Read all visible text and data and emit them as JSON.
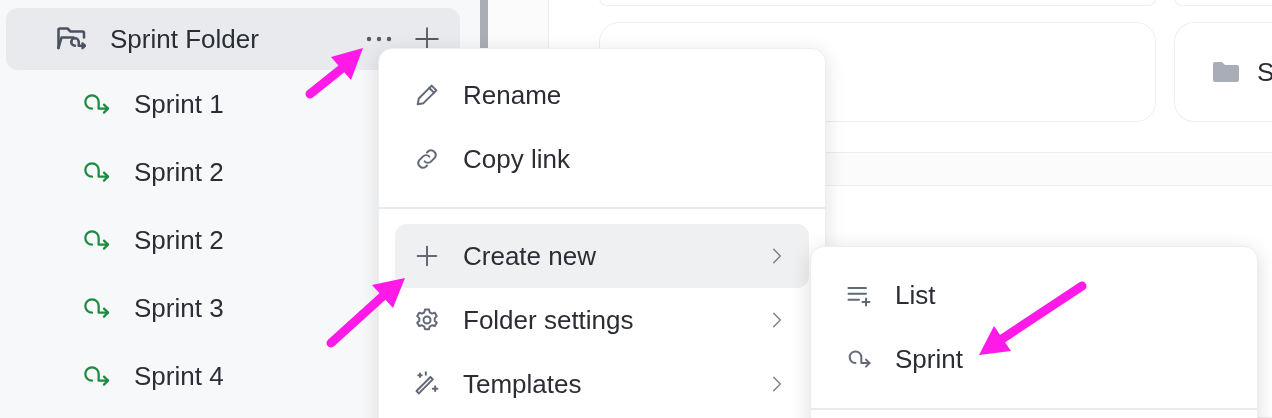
{
  "sidebar": {
    "folder": {
      "label": "Sprint Folder",
      "selected": true,
      "children": [
        {
          "label": "Sprint 1"
        },
        {
          "label": "Sprint 2"
        },
        {
          "label": "Sprint 2"
        },
        {
          "label": "Sprint 3"
        },
        {
          "label": "Sprint 4"
        }
      ]
    }
  },
  "cards": [
    {
      "kind": "empty"
    },
    {
      "kind": "folder",
      "label": "S"
    }
  ],
  "context_menu": {
    "sections": [
      [
        {
          "kind": "rename",
          "label": "Rename",
          "selected": false,
          "has_submenu": false
        },
        {
          "kind": "link",
          "label": "Copy link",
          "selected": false,
          "has_submenu": false
        }
      ],
      [
        {
          "kind": "create",
          "label": "Create new",
          "selected": true,
          "has_submenu": true
        },
        {
          "kind": "settings",
          "label": "Folder settings",
          "selected": false,
          "has_submenu": true
        },
        {
          "kind": "templates",
          "label": "Templates",
          "selected": false,
          "has_submenu": true
        }
      ]
    ]
  },
  "submenu": {
    "items": [
      {
        "kind": "list",
        "label": "List"
      },
      {
        "kind": "sprint",
        "label": "Sprint"
      }
    ]
  }
}
